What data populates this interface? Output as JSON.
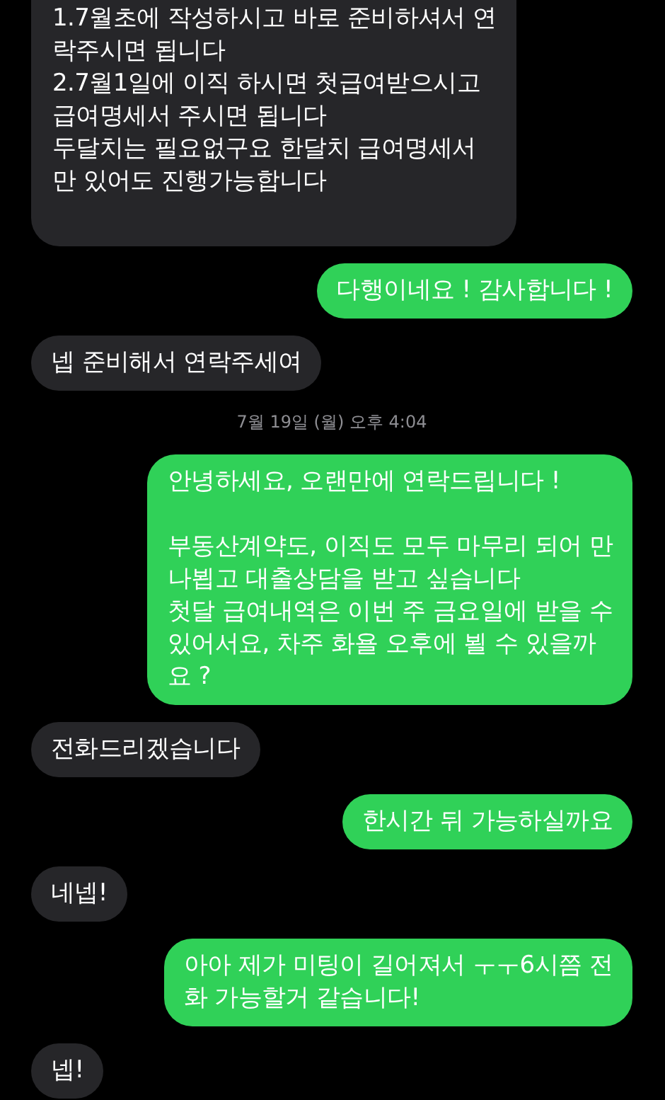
{
  "messages": [
    {
      "kind": "received",
      "text": "1.7월초에 작성하시고 바로 준비하셔서 연\n락주시면 됩니다\n2.7월1일에 이직 하시면 첫급여받으시고\n급여명세서 주시면 됩니다\n두달치는 필요없구요 한달치 급여명세서\n만 있어도 진행가능합니다"
    },
    {
      "kind": "sent",
      "text": "다행이네요 ! 감사합니다 !"
    },
    {
      "kind": "received",
      "text": "넵 준비해서 연락주세여"
    },
    {
      "kind": "timestamp",
      "text": "7월 19일 (월) 오후 4:04"
    },
    {
      "kind": "sent",
      "text": "안녕하세요, 오랜만에 연락드립니다 !\n\n부동산계약도, 이직도 모두 마무리 되어 만\n나뵙고 대출상담을 받고 싶습니다\n첫달 급여내역은 이번 주 금요일에 받을 수\n있어서요, 차주 화욜 오후에 뵐 수 있을까\n요 ?"
    },
    {
      "kind": "received",
      "text": "전화드리겠습니다"
    },
    {
      "kind": "sent",
      "text": "한시간 뒤 가능하실까요"
    },
    {
      "kind": "received",
      "text": "네넵!"
    },
    {
      "kind": "sent",
      "text": "아아 제가 미팅이 길어져서 ㅜㅜ6시쯤 전\n화 가능할거 같습니다!"
    },
    {
      "kind": "received",
      "text": "넵!"
    }
  ]
}
